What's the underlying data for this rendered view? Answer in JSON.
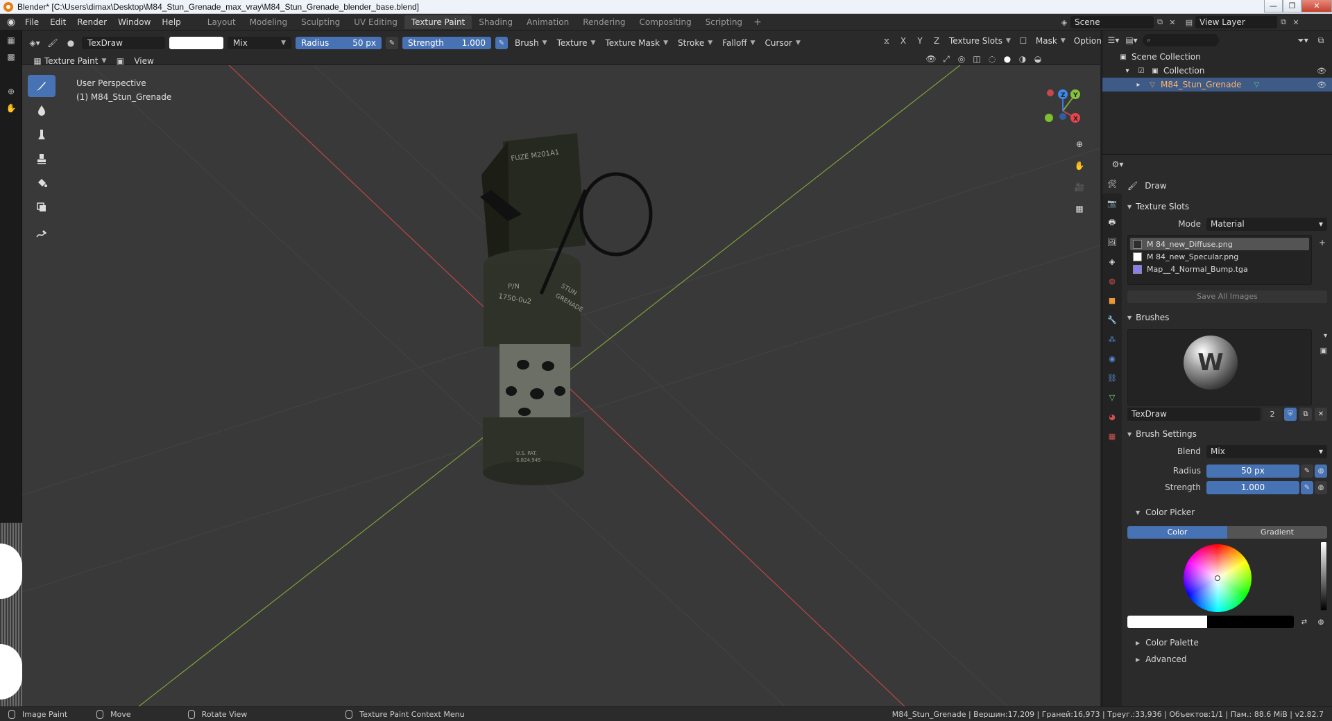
{
  "window": {
    "title": "Blender* [C:\\Users\\dimax\\Desktop\\M84_Stun_Grenade_max_vray\\M84_Stun_Grenade_blender_base.blend]",
    "controls": [
      "—",
      "❐",
      "✕"
    ]
  },
  "menubar": {
    "items": [
      "File",
      "Edit",
      "Render",
      "Window",
      "Help"
    ],
    "workspaces": [
      "Layout",
      "Modeling",
      "Sculpting",
      "UV Editing",
      "Texture Paint",
      "Shading",
      "Animation",
      "Rendering",
      "Compositing",
      "Scripting"
    ],
    "active_workspace": "Texture Paint",
    "add_label": "+",
    "scene": "Scene",
    "view_layer": "View Layer"
  },
  "tool_header": {
    "brush_name": "TexDraw",
    "blend_mode": "Mix",
    "radius_label": "Radius",
    "radius_value": "50 px",
    "strength_label": "Strength",
    "strength_value": "1.000",
    "menus": [
      "Brush",
      "Texture",
      "Texture Mask",
      "Stroke",
      "Falloff",
      "Cursor"
    ],
    "axes": [
      "X",
      "Y",
      "Z"
    ],
    "texture_slots_label": "Texture Slots",
    "mask_label": "Mask",
    "options_label": "Options"
  },
  "mode_header": {
    "mode": "Texture Paint",
    "view_label": "View"
  },
  "viewport": {
    "perspective_label": "User Perspective",
    "object_label": "(1) M84_Stun_Grenade",
    "grenade_text": [
      "FUZE M201A1",
      "P/N",
      "1750-0u2",
      "STUN",
      "GRENADE",
      "U.S. PAT.",
      "5,824,945"
    ],
    "gizmo_axes": [
      "X",
      "Y",
      "Z"
    ],
    "colors": {
      "background": "#393939",
      "x_axis": "#c0464a",
      "y_axis": "#7da33a",
      "grid": "#434343"
    }
  },
  "outliner": {
    "items": [
      {
        "label": "Scene Collection",
        "indent": 0
      },
      {
        "label": "Collection",
        "indent": 1
      },
      {
        "label": "M84_Stun_Grenade",
        "indent": 2,
        "selected": true
      }
    ]
  },
  "properties": {
    "tool_label": "Draw",
    "texture_slots": {
      "title": "Texture Slots",
      "mode_label": "Mode",
      "mode_value": "Material",
      "slots": [
        {
          "name": "M 84_new_Diffuse.png",
          "active": true,
          "color": "#2e2e2e"
        },
        {
          "name": "M 84_new_Specular.png",
          "active": false,
          "color": "#ffffff"
        },
        {
          "name": "Map__4_Normal_Bump.tga",
          "active": false,
          "color": "#8a7df0"
        }
      ],
      "save_all": "Save All Images"
    },
    "brushes": {
      "title": "Brushes",
      "brush_name": "TexDraw",
      "users": "2"
    },
    "brush_settings": {
      "title": "Brush Settings",
      "blend_label": "Blend",
      "blend_value": "Mix",
      "radius_label": "Radius",
      "radius_value": "50 px",
      "strength_label": "Strength",
      "strength_value": "1.000"
    },
    "color_picker": {
      "title": "Color Picker",
      "tab_color": "Color",
      "tab_gradient": "Gradient"
    },
    "color_palette": "Color Palette",
    "advanced": "Advanced"
  },
  "statusbar": {
    "hints": [
      "Image Paint",
      "Move",
      "Rotate View",
      "Texture Paint Context Menu"
    ],
    "stats": "M84_Stun_Grenade | Вершин:17,209 | Граней:16,973 | Треуг.:33,936 | Объектов:1/1 | Пам.: 88.6 MiB | v2.82.7"
  }
}
